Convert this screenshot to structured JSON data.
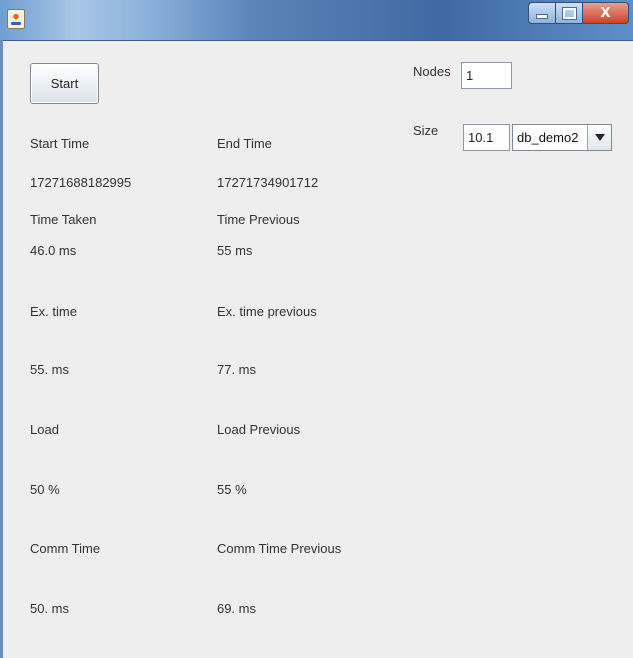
{
  "window": {
    "controls": {
      "close_glyph": "X"
    }
  },
  "toolbar": {
    "start_label": "Start"
  },
  "settings": {
    "nodes_label": "Nodes",
    "nodes_value": "1",
    "size_label": "Size",
    "size_value": "10.1",
    "database": {
      "selected": "db_demo2"
    }
  },
  "metrics": {
    "start_time": {
      "label": "Start Time",
      "value": "17271688182995"
    },
    "end_time": {
      "label": "End Time",
      "value": "17271734901712"
    },
    "time_taken": {
      "label": "Time Taken",
      "value": "46.0 ms"
    },
    "time_previous": {
      "label": "Time Previous",
      "value": "55 ms"
    },
    "ex_time": {
      "label": "Ex. time",
      "value": "55. ms"
    },
    "ex_time_previous": {
      "label": "Ex. time previous",
      "value": "77. ms"
    },
    "load": {
      "label": "Load",
      "value": "50 %"
    },
    "load_previous": {
      "label": "Load Previous",
      "value": "55 %"
    },
    "comm_time": {
      "label": "Comm Time",
      "value": "50. ms"
    },
    "comm_time_previous": {
      "label": "Comm Time Previous",
      "value": "69. ms"
    }
  },
  "colors": {
    "window_background": "#eeeeee",
    "titlebar_accent": "#3f6aa1",
    "close_button": "#c9452c"
  }
}
